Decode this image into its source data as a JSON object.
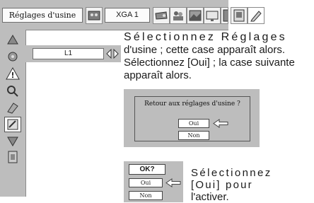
{
  "menu_bar": {
    "active_tab": "Réglages d'usine",
    "resolution": "XGA 1",
    "icons": [
      "palette-icon",
      "projector-icon",
      "people-icon",
      "image-icon",
      "screen-icon",
      "film-icon",
      "pencil-icon"
    ]
  },
  "sidebar": {
    "icons": [
      "triangle-up-icon",
      "settings-icon",
      "warning-icon",
      "filter-icon",
      "search-icon",
      "factory-default-icon",
      "triangle-down-icon",
      "exit-icon"
    ],
    "selected": "factory-default-icon"
  },
  "selector": {
    "value": "L1"
  },
  "description": {
    "line1": "Sélectionnez Réglages",
    "rest": "d'usine ; cette case apparaît alors. Sélectionnez [Oui] ; la case suivante apparaît alors."
  },
  "reset_dialog": {
    "question": "Retour aux réglages d'usine ?",
    "yes": "Oui",
    "no": "Non"
  },
  "confirm_dialog": {
    "title": "OK?",
    "yes": "Oui",
    "no": "Non"
  },
  "instruction": {
    "line1": "Sélectionnez",
    "line2": "[Oui] pour",
    "line3": "l'activer."
  },
  "colors": {
    "panel_gray": "#bdbdbd",
    "text": "#1a1a1a"
  }
}
